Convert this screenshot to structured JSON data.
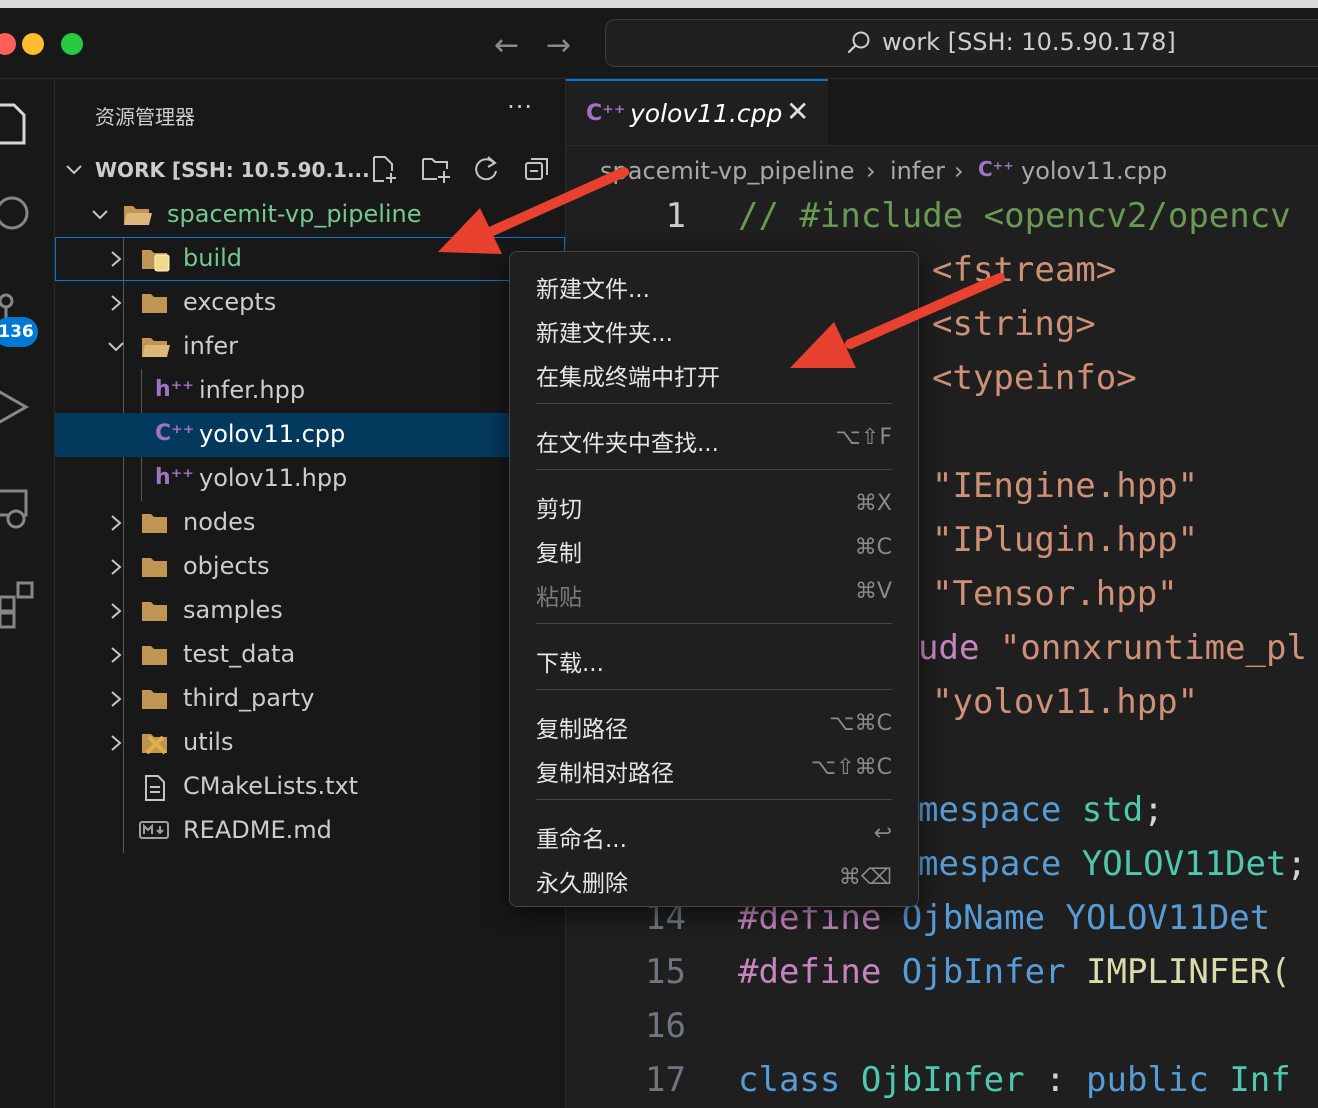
{
  "titlebar": {
    "nav_back": "←",
    "nav_forward": "→",
    "command_center": "work [SSH: 10.5.90.178]"
  },
  "activity_bar": {
    "badge": "136"
  },
  "sidebar": {
    "title": "资源管理器",
    "more": "···",
    "workspace_label": "WORK [SSH: 10.5.90.1...",
    "root_folder": "spacemit-vp_pipeline",
    "items": [
      {
        "label": "build"
      },
      {
        "label": "excepts"
      },
      {
        "label": "infer"
      },
      {
        "label": "infer.hpp"
      },
      {
        "label": "yolov11.cpp"
      },
      {
        "label": "yolov11.hpp"
      },
      {
        "label": "nodes"
      },
      {
        "label": "objects"
      },
      {
        "label": "samples"
      },
      {
        "label": "test_data"
      },
      {
        "label": "third_party"
      },
      {
        "label": "utils"
      },
      {
        "label": "CMakeLists.txt"
      },
      {
        "label": "README.md"
      }
    ]
  },
  "editor": {
    "tab_label": "yolov11.cpp",
    "tab_close": "✕",
    "breadcrumb": [
      "spacemit-vp_pipeline",
      "infer",
      "yolov11.cpp"
    ],
    "line_numbers": [
      "1",
      "14",
      "15",
      "16",
      "17"
    ],
    "code": {
      "l1": "// #include <opencv2/opencv",
      "l2": "<fstream>",
      "l3": "<string>",
      "l4": "<typeinfo>",
      "l5": "\"IEngine.hpp\"",
      "l6": "\"IPlugin.hpp\"",
      "l7": "\"Tensor.hpp\"",
      "l8a": "ude ",
      "l8b": "\"onnxruntime_pl",
      "l9": "\"yolov11.hpp\"",
      "l10a": "mespace ",
      "l10b": "std",
      "l10c": ";",
      "l11a": "mespace ",
      "l11b": "YOLOV11Det",
      "l11c": ";",
      "l14a": "#define ",
      "l14b": "OjbName ",
      "l14c": "YOLOV11Det",
      "l15a": "#define ",
      "l15b": "OjbInfer ",
      "l15c": "IMPLINFER",
      "l15d": "(",
      "l17a": "class ",
      "l17b": "OjbInfer ",
      "l17c": ": ",
      "l17d": "public ",
      "l17e": "Inf"
    }
  },
  "context_menu": {
    "items": [
      {
        "label": "新建文件...",
        "shortcut": ""
      },
      {
        "label": "新建文件夹...",
        "shortcut": ""
      },
      {
        "label": "在集成终端中打开",
        "shortcut": ""
      },
      {
        "label": "在文件夹中查找...",
        "shortcut": "⌥⇧F"
      },
      {
        "label": "剪切",
        "shortcut": "⌘X"
      },
      {
        "label": "复制",
        "shortcut": "⌘C"
      },
      {
        "label": "粘贴",
        "shortcut": "⌘V"
      },
      {
        "label": "下载...",
        "shortcut": ""
      },
      {
        "label": "复制路径",
        "shortcut": "⌥⌘C"
      },
      {
        "label": "复制相对路径",
        "shortcut": "⌥⇧⌘C"
      },
      {
        "label": "重命名...",
        "shortcut": "↩"
      },
      {
        "label": "永久删除",
        "shortcut": "⌘⌫"
      }
    ]
  },
  "colors": {
    "accent": "#0078d4",
    "selection": "#04395e",
    "folder": "#c09553",
    "git_added": "#73c991",
    "arrow": "#e8412f"
  }
}
